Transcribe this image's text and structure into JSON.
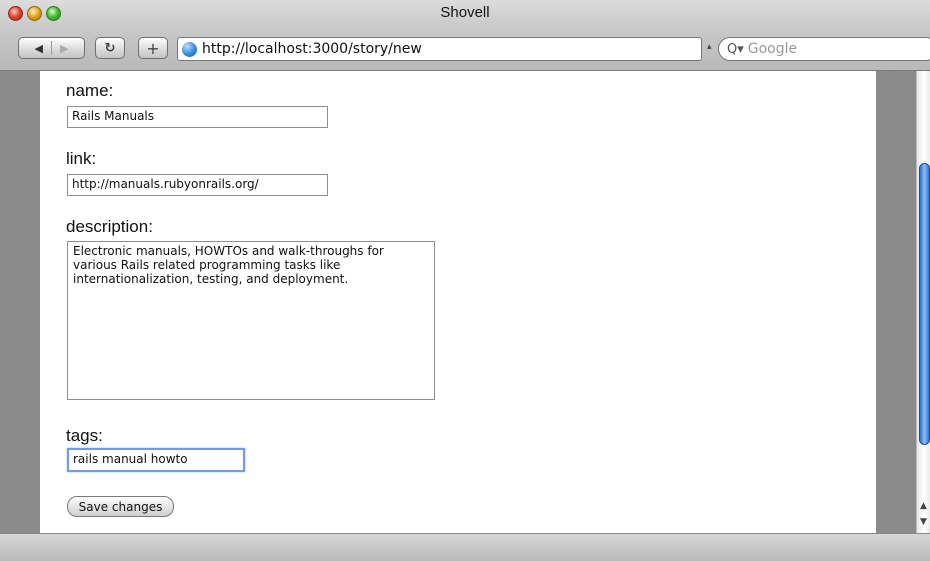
{
  "window": {
    "title": "Shovell"
  },
  "toolbar": {
    "back_icon": "back-arrow-icon",
    "forward_icon": "forward-arrow-icon",
    "reload_icon": "reload-icon",
    "add_icon": "plus-icon",
    "url": "http://localhost:3000/story/new",
    "search_placeholder": "Google"
  },
  "form": {
    "name_label": "name:",
    "name_value": "Rails Manuals",
    "link_label": "link:",
    "link_value": "http://manuals.rubyonrails.org/",
    "description_label": "description:",
    "description_value": "Electronic manuals, HOWTOs and walk-throughs for\nvarious Rails related programming tasks like\ninternationalization, testing, and deployment.",
    "tags_label": "tags:",
    "tags_value": "rails manual howto",
    "save_label": "Save changes"
  }
}
